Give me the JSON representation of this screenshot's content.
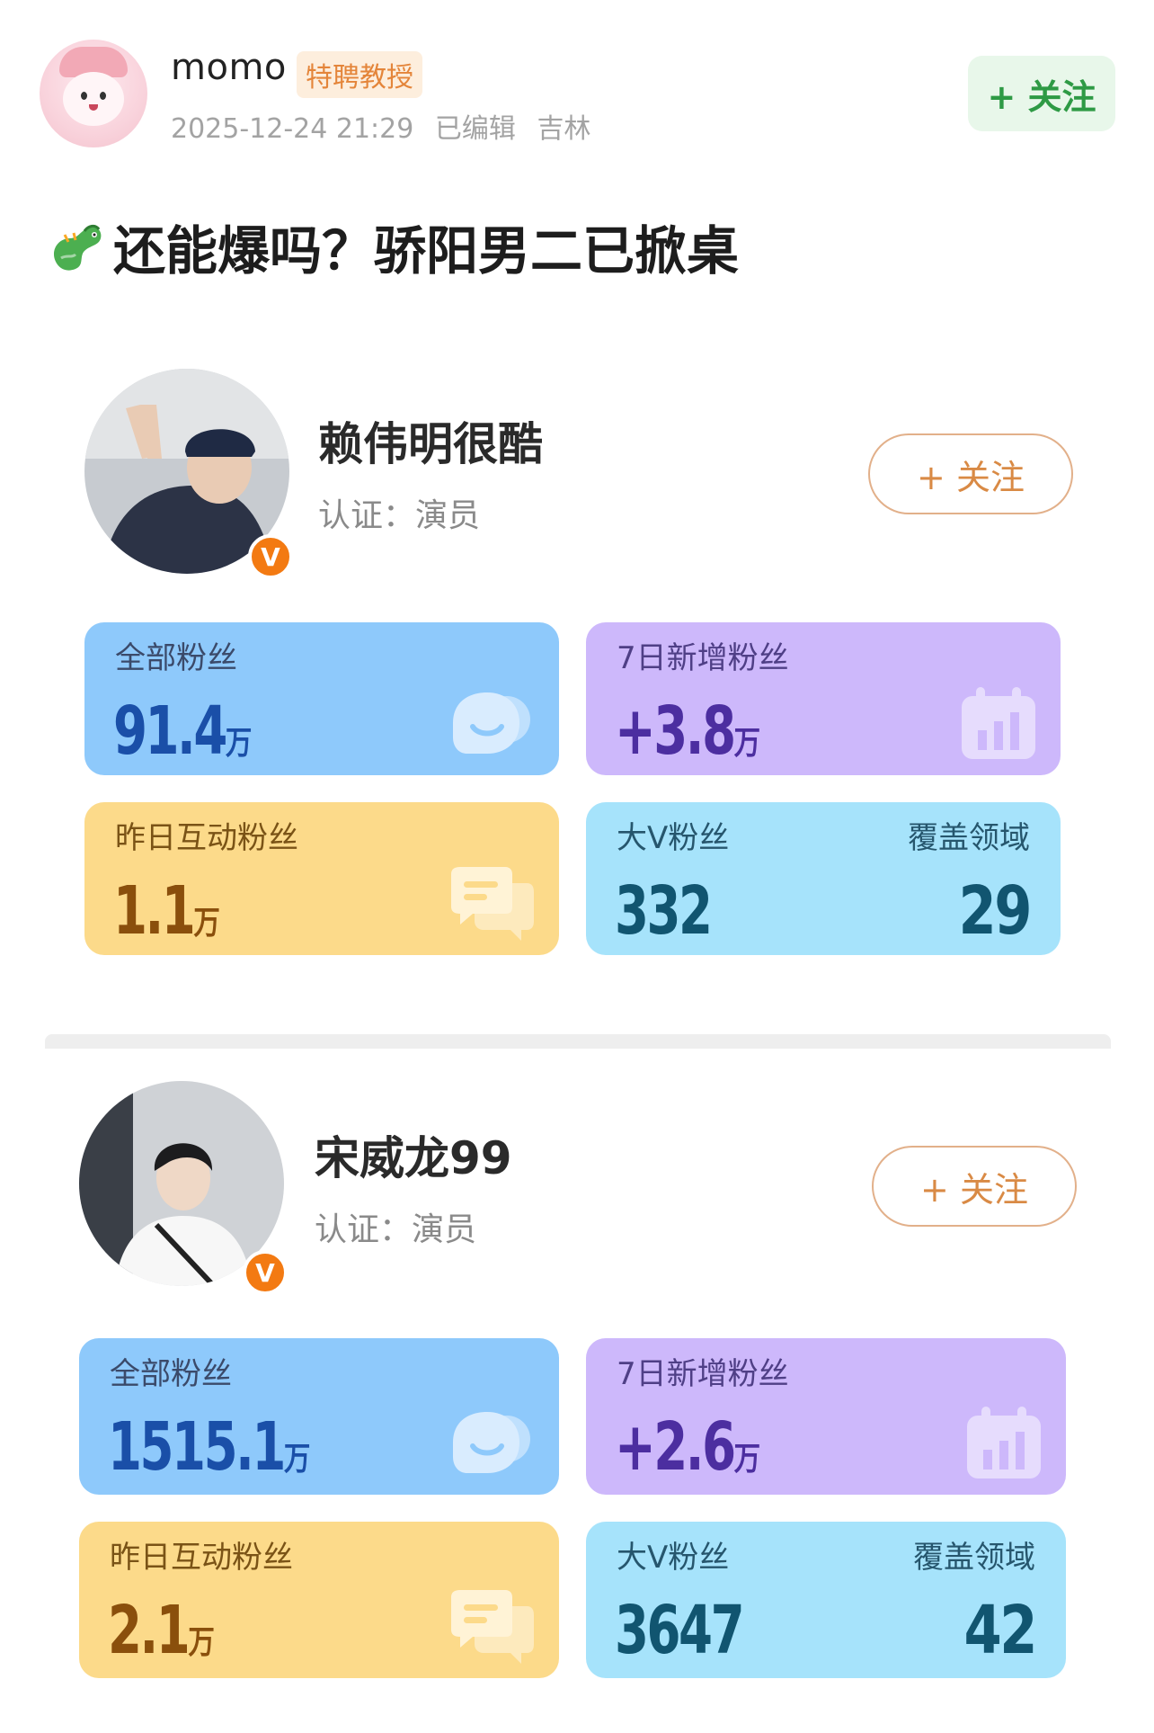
{
  "post": {
    "author": {
      "name": "momo",
      "badge": "特聘教授",
      "timestamp": "2025-12-24 21:29",
      "edited": "已编辑",
      "location": "吉林"
    },
    "follow_label": "+ 关注",
    "title": "还能爆吗？骄阳男二已掀桌"
  },
  "profiles": [
    {
      "name": "赖伟明很酷",
      "cert": "认证：演员",
      "verified_mark": "V",
      "follow_label": "+ 关注",
      "stats": {
        "total_fans_label": "全部粉丝",
        "total_fans_value": "91.4",
        "total_fans_unit": "万",
        "new_fans_label": "7日新增粉丝",
        "new_fans_value": "+3.8",
        "new_fans_unit": "万",
        "interactive_label": "昨日互动粉丝",
        "interactive_value": "1.1",
        "interactive_unit": "万",
        "bigv_label": "大V粉丝",
        "bigv_value": "332",
        "domain_label": "覆盖领域",
        "domain_value": "29"
      }
    },
    {
      "name": "宋威龙99",
      "cert": "认证：演员",
      "verified_mark": "V",
      "follow_label": "+ 关注",
      "stats": {
        "total_fans_label": "全部粉丝",
        "total_fans_value": "1515.1",
        "total_fans_unit": "万",
        "new_fans_label": "7日新增粉丝",
        "new_fans_value": "+2.6",
        "new_fans_unit": "万",
        "interactive_label": "昨日互动粉丝",
        "interactive_value": "2.1",
        "interactive_unit": "万",
        "bigv_label": "大V粉丝",
        "bigv_value": "3647",
        "domain_label": "覆盖领域",
        "domain_value": "42"
      }
    }
  ],
  "colors": {
    "follow_green": "#2e9a45",
    "badge_orange": "#e4853a",
    "tile_blue": "#8ec9fb",
    "tile_purple": "#cdb8fb",
    "tile_yellow": "#fcda8a",
    "tile_cyan": "#a6e3fb",
    "verified_orange": "#f37a12"
  },
  "icons": [
    "dragon-emoji-icon",
    "fans-face-icon",
    "calendar-chart-icon",
    "chat-bubble-icon"
  ]
}
